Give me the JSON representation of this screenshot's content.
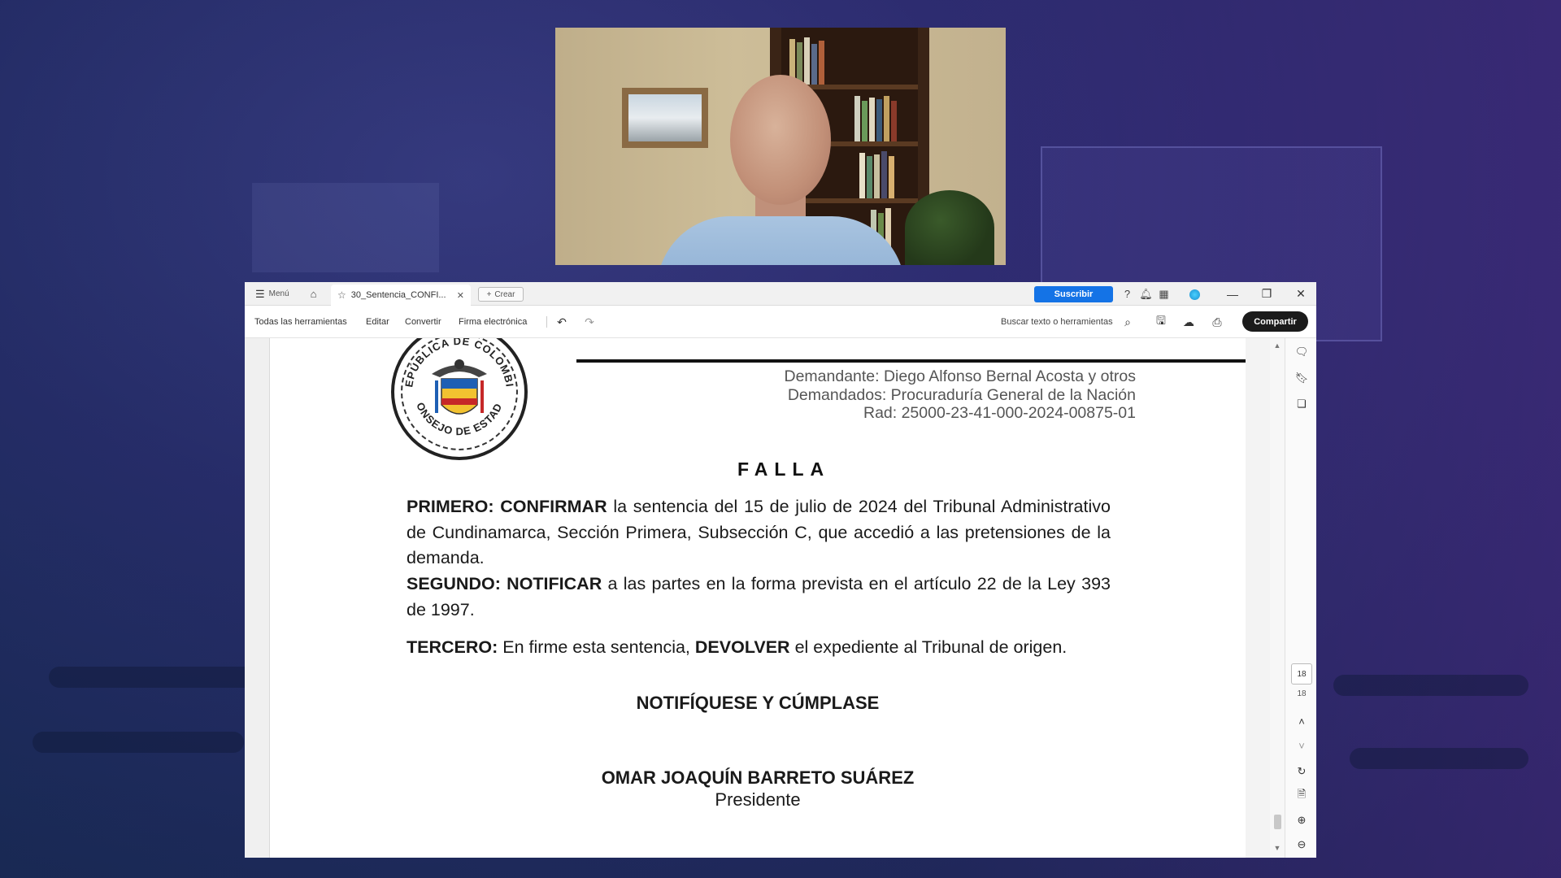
{
  "webcam": {
    "description_name": "presenter-webcam"
  },
  "app": {
    "titlebar": {
      "menu_label": "Menú",
      "tab_label": "30_Sentencia_CONFI...",
      "crear_label": "Crear",
      "suscribir_label": "Suscribir"
    },
    "toolbar": {
      "items": [
        "Todas las herramientas",
        "Editar",
        "Convertir",
        "Firma electrónica"
      ],
      "search_label": "Buscar texto o herramientas",
      "share_label": "Compartir"
    },
    "page_nav": {
      "current": "18",
      "total": "18"
    }
  },
  "document": {
    "seal_text_top": "REPÚBLICA DE COLOMBIA",
    "seal_text_bottom": "CONSEJO DE ESTADO",
    "parties": [
      "Demandante: Diego Alfonso Bernal Acosta y otros",
      "Demandados: Procuraduría General de la Nación",
      "Rad: 25000-23-41-000-2024-00875-01"
    ],
    "heading": "FALLA",
    "primero_label": "PRIMERO:",
    "primero_verb": "CONFIRMAR",
    "primero_text": "la sentencia del 15 de julio de 2024 del Tribunal Administrativo de Cundinamarca, Sección Primera, Subsección C, que accedió a las pretensiones de la demanda.",
    "segundo_label": "SEGUNDO:",
    "segundo_verb": "NOTIFICAR",
    "segundo_text": "a las partes en la forma prevista en el artículo 22 de la Ley 393 de 1997.",
    "tercero_label": "TERCERO:",
    "tercero_text_a": "En firme esta sentencia,",
    "tercero_verb": "DEVOLVER",
    "tercero_text_b": "el expediente al Tribunal de origen.",
    "closing": "NOTIFÍQUESE Y CÚMPLASE",
    "signer_name": "OMAR JOAQUÍN BARRETO SUÁREZ",
    "signer_role": "Presidente"
  },
  "colors": {
    "accent": "#1473e6",
    "share_button": "#1b1b1b"
  }
}
